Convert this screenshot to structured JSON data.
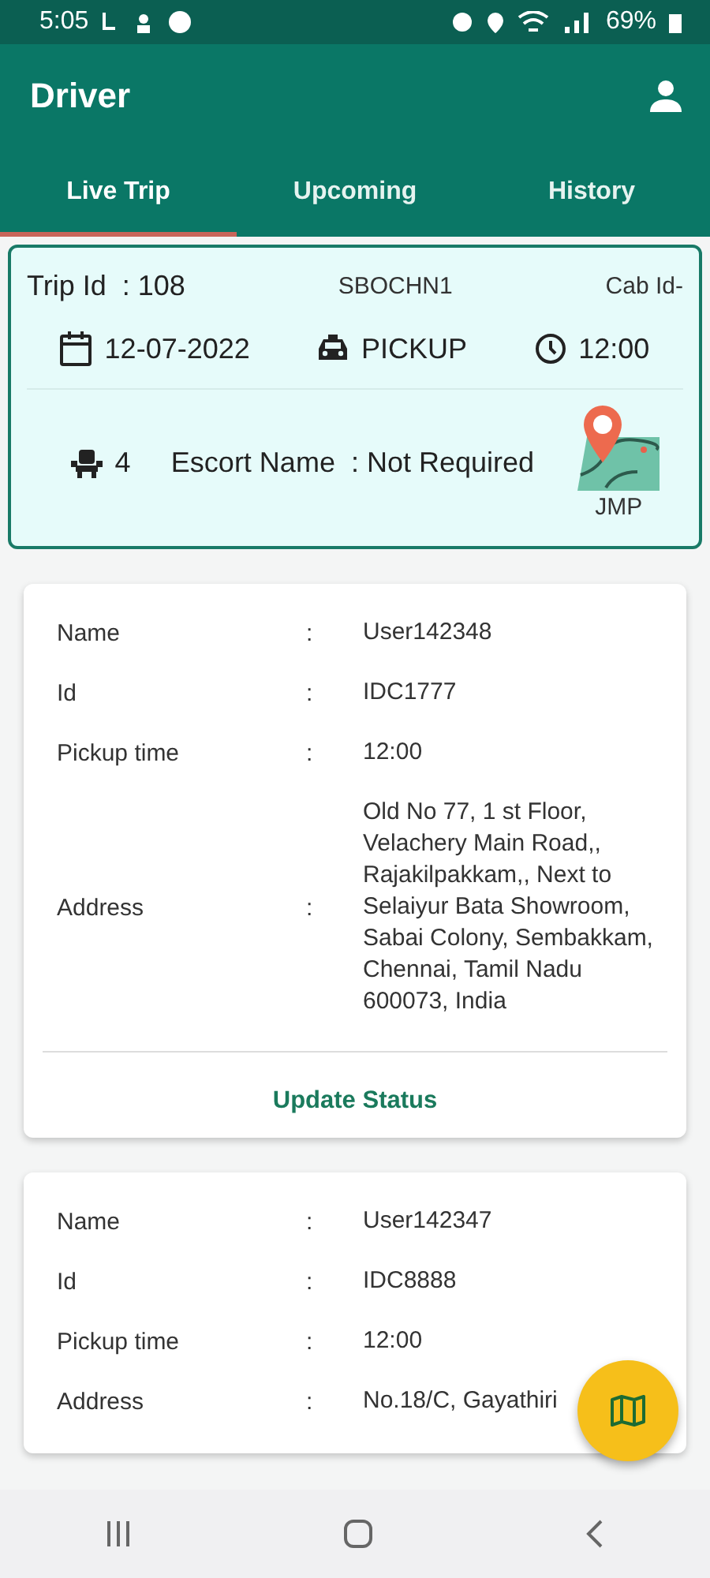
{
  "status_bar": {
    "time": "5:05",
    "battery": "69%"
  },
  "app_bar": {
    "title": "Driver"
  },
  "tabs": [
    {
      "label": "Live Trip",
      "selected": true
    },
    {
      "label": "Upcoming",
      "selected": false
    },
    {
      "label": "History",
      "selected": false
    }
  ],
  "trip": {
    "trip_id_label": "Trip Id",
    "trip_id": "108",
    "route": "SBOCHN1",
    "cab_id": "Cab Id-",
    "date": "12-07-2022",
    "trip_type": "PICKUP",
    "time": "12:00",
    "seats": "4",
    "escort_label": "Escort Name",
    "escort": "Not Required",
    "map_label": "JMP"
  },
  "passengers": [
    {
      "fields": [
        {
          "label": "Name",
          "value": "User142348"
        },
        {
          "label": "Id",
          "value": "IDC1777"
        },
        {
          "label": "Pickup time",
          "value": "12:00"
        },
        {
          "label": "Address",
          "value": "Old No 77, 1 st Floor, Velachery Main Road,, Rajakilpakkam,, Next to Selaiyur Bata Showroom, Sabai Colony, Sembakkam, Chennai, Tamil Nadu 600073, India"
        }
      ],
      "action": "Update Status"
    },
    {
      "fields": [
        {
          "label": "Name",
          "value": "User142347"
        },
        {
          "label": "Id",
          "value": "IDC8888"
        },
        {
          "label": "Pickup time",
          "value": "12:00"
        },
        {
          "label": "Address",
          "value": "No.18/C, Gayathiri"
        }
      ]
    }
  ],
  "separator": ":"
}
